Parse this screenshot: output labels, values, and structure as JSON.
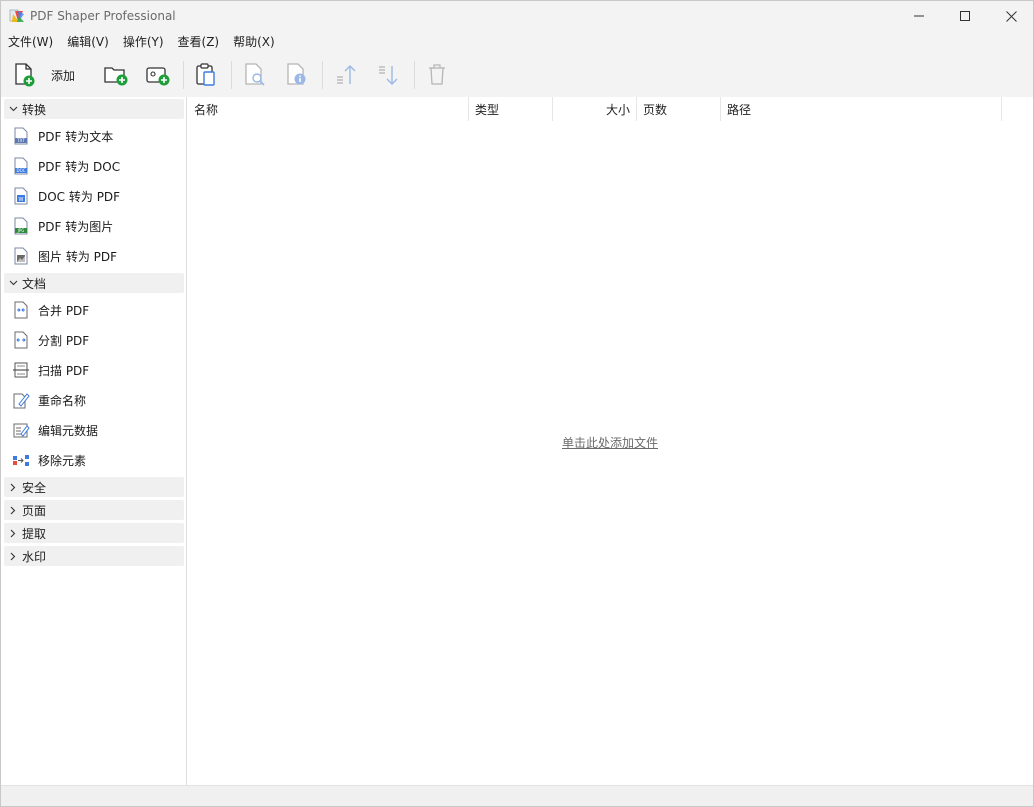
{
  "window": {
    "title": "PDF Shaper Professional"
  },
  "menu": [
    {
      "label": "文件(W)"
    },
    {
      "label": "编辑(V)"
    },
    {
      "label": "操作(Y)"
    },
    {
      "label": "查看(Z)"
    },
    {
      "label": "帮助(X)"
    }
  ],
  "toolbar": {
    "add_label": "添加"
  },
  "sidebar": {
    "groups": [
      {
        "label": "转换",
        "expanded": true,
        "items": [
          {
            "label": "PDF 转为文本",
            "icon": "pdf-to-txt-icon"
          },
          {
            "label": "PDF 转为 DOC",
            "icon": "pdf-to-doc-icon"
          },
          {
            "label": "DOC 转为 PDF",
            "icon": "doc-to-pdf-icon"
          },
          {
            "label": "PDF 转为图片",
            "icon": "pdf-to-jpg-icon"
          },
          {
            "label": "图片 转为 PDF",
            "icon": "image-to-pdf-icon"
          }
        ]
      },
      {
        "label": "文档",
        "expanded": true,
        "items": [
          {
            "label": "合并 PDF",
            "icon": "merge-icon"
          },
          {
            "label": "分割 PDF",
            "icon": "split-icon"
          },
          {
            "label": "扫描 PDF",
            "icon": "scan-icon"
          },
          {
            "label": "重命名称",
            "icon": "rename-icon"
          },
          {
            "label": "编辑元数据",
            "icon": "metadata-icon"
          },
          {
            "label": "移除元素",
            "icon": "remove-elements-icon"
          }
        ]
      },
      {
        "label": "安全",
        "expanded": false
      },
      {
        "label": "页面",
        "expanded": false
      },
      {
        "label": "提取",
        "expanded": false
      },
      {
        "label": "水印",
        "expanded": false
      }
    ]
  },
  "table": {
    "columns": [
      "名称",
      "类型",
      "大小",
      "页数",
      "路径"
    ],
    "empty_text": "单击此处添加文件"
  },
  "colors": {
    "chrome_bg": "#f3f3f3",
    "group_bg": "#f0f0f0",
    "accent_green": "#1e9e3a",
    "icon_blue": "#3d7be0"
  }
}
